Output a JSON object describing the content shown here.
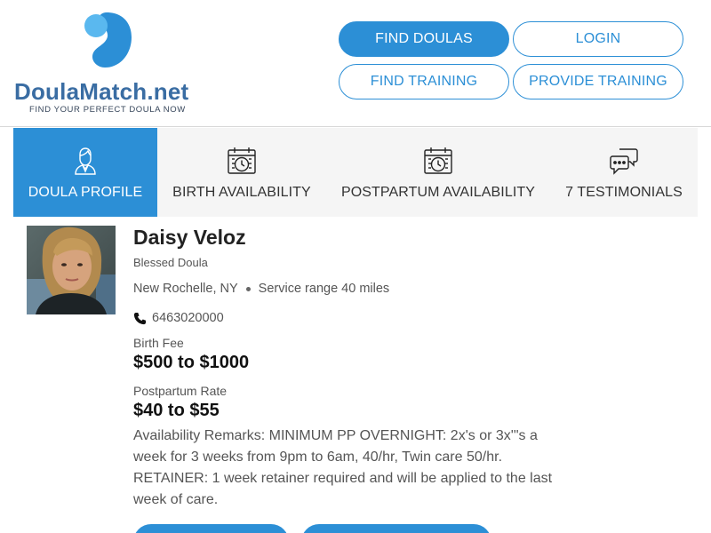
{
  "logo": {
    "name_part1": "DoulaMatch",
    "name_part2": ".net",
    "tagline": "FIND YOUR PERFECT DOULA NOW",
    "colors": {
      "light": "#5ab8ef",
      "dark": "#2c8fd6"
    }
  },
  "nav": {
    "find_doulas": "FIND DOULAS",
    "login": "LOGIN",
    "find_training": "FIND TRAINING",
    "provide_training": "PROVIDE TRAINING"
  },
  "tabs": [
    {
      "label": "DOULA PROFILE",
      "icon": "person-icon",
      "active": true
    },
    {
      "label": "BIRTH AVAILABILITY",
      "icon": "calendar-clock-icon",
      "active": false
    },
    {
      "label": "POSTPARTUM AVAILABILITY",
      "icon": "calendar-clock-icon",
      "active": false
    },
    {
      "label": "7 TESTIMONIALS",
      "icon": "chat-bubbles-icon",
      "active": false
    }
  ],
  "profile": {
    "name": "Daisy Veloz",
    "subtitle": "Blessed Doula",
    "location": "New Rochelle, NY",
    "service_range": "Service range 40 miles",
    "phone": "6463020000",
    "birth_fee_label": "Birth Fee",
    "birth_fee": "$500 to $1000",
    "postpartum_label": "Postpartum Rate",
    "postpartum_rate": "$40 to $55",
    "remarks": "Availability Remarks: MINIMUM PP OVERNIGHT: 2x's or 3x'\"s a week for 3 weeks from 9pm to 6am, 40/hr, Twin care 50/hr. RETAINER: 1 week retainer required and will be applied to the last week of care."
  },
  "theme": {
    "accent": "#2c8fd6",
    "tab_bg": "#f5f5f5"
  }
}
